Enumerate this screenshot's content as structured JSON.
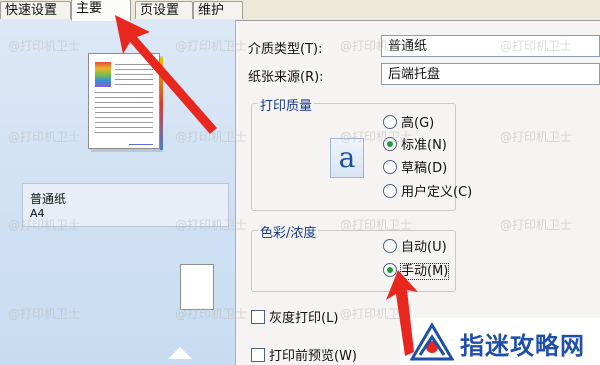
{
  "tabs": [
    {
      "label": "快速设置",
      "active": false
    },
    {
      "label": "主要",
      "active": true
    },
    {
      "label": "页设置",
      "active": false
    },
    {
      "label": "维护",
      "active": false
    }
  ],
  "preview": {
    "media_name": "普通纸",
    "media_size": "A4"
  },
  "form": {
    "media_type_label": "介质类型(T):",
    "media_type_value": "普通纸",
    "paper_source_label": "纸张来源(R):",
    "paper_source_value": "后端托盘"
  },
  "print_quality": {
    "title": "打印质量",
    "icon_glyph": "a",
    "options": [
      {
        "label": "高(G)",
        "selected": false
      },
      {
        "label": "标准(N)",
        "selected": true
      },
      {
        "label": "草稿(D)",
        "selected": false
      },
      {
        "label": "用户定义(C)",
        "selected": false
      }
    ]
  },
  "color_intensity": {
    "title": "色彩/浓度",
    "options": [
      {
        "label": "自动(U)",
        "selected": false
      },
      {
        "label": "手动(M)",
        "selected": true
      }
    ]
  },
  "checkboxes": {
    "grayscale_label": "灰度打印(L)",
    "preview_label": "打印前预览(W)"
  },
  "watermark_text": "@打印机卫士",
  "logo_text": "指迷攻略网",
  "colors": {
    "accent_blue": "#1f4fa8",
    "arrow_red": "#e8281e",
    "group_title_blue": "#1b3a8a",
    "radio_selected_green": "#1f9e2f"
  }
}
